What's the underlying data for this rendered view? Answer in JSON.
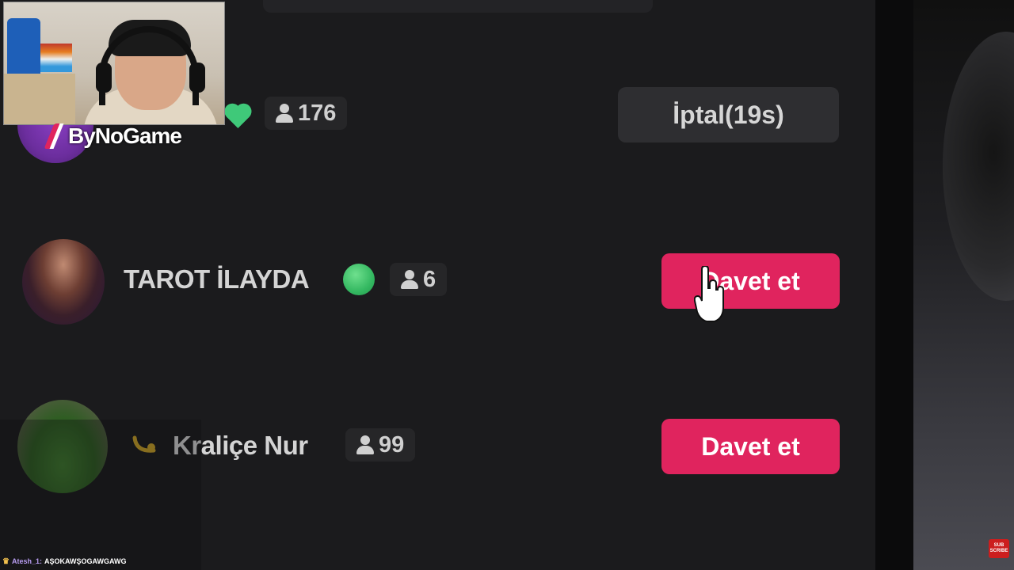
{
  "rows": [
    {
      "name": "",
      "count": "176",
      "action": "İptal(19s)",
      "action_style": "gray",
      "verified_color": "#3fc979"
    },
    {
      "name": "TAROT İLAYDA",
      "count": "6",
      "action": "Davet et",
      "action_style": "pink",
      "verified_color": "#34b861"
    },
    {
      "name": "Kraliçe Nur",
      "count": "99",
      "action": "Davet et",
      "action_style": "pink"
    }
  ],
  "overlay": {
    "brand": "ByNoGame",
    "chat_user": "Atesh_1:",
    "chat_message": "AŞOKAWŞOGAWGAWG",
    "subscribe_top": "SUB",
    "subscribe_bottom": "SCRIBE"
  },
  "colors": {
    "background": "#1b1b1d",
    "invite_button": "#e0245e",
    "cancel_button": "#2e2e31",
    "count_chip": "#262628"
  },
  "icons": [
    "person-icon",
    "green-heart-icon",
    "green-dot-icon",
    "hand-cursor-icon",
    "crown-icon"
  ]
}
